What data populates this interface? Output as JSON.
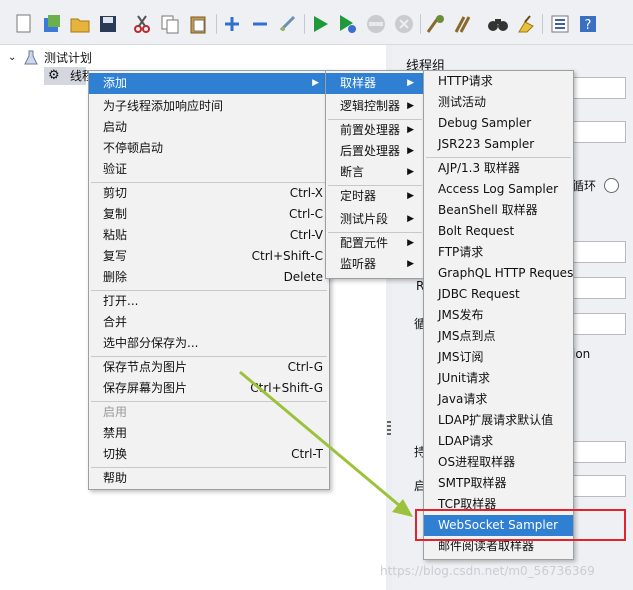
{
  "toolbar": {
    "icons": [
      "new-icon",
      "templates-icon",
      "open-icon",
      "save-icon",
      "cut-icon",
      "copy-icon",
      "paste-icon",
      "expand-icon",
      "collapse-icon",
      "toggle-icon",
      "start-icon",
      "start-no-pause-icon",
      "stop-icon",
      "shutdown-icon",
      "clear-icon",
      "clear-all-icon",
      "search-icon",
      "reset-search-icon",
      "function-helper-icon",
      "help-icon"
    ]
  },
  "tree": {
    "root_label": "测试计划",
    "child_label": "线程组"
  },
  "right_panel": {
    "title": "线程组",
    "frag_loop": "循环",
    "frag_r": "R",
    "frag_wei": "循",
    "frag_ion": "ion",
    "frag_chi": "持",
    "frag_qi": "启"
  },
  "context_menu": {
    "items": [
      {
        "label": "添加",
        "shortcut": "",
        "submenu": true,
        "highlighted": true
      },
      {
        "label": "为子线程添加响应时间",
        "shortcut": ""
      },
      {
        "label": "启动",
        "shortcut": ""
      },
      {
        "label": "不停顿启动",
        "shortcut": ""
      },
      {
        "label": "验证",
        "shortcut": ""
      },
      {
        "label": "剪切",
        "shortcut": "Ctrl-X"
      },
      {
        "label": "复制",
        "shortcut": "Ctrl-C"
      },
      {
        "label": "粘贴",
        "shortcut": "Ctrl-V"
      },
      {
        "label": "复写",
        "shortcut": "Ctrl+Shift-C"
      },
      {
        "label": "删除",
        "shortcut": "Delete"
      },
      {
        "label": "打开...",
        "shortcut": ""
      },
      {
        "label": "合并",
        "shortcut": ""
      },
      {
        "label": "选中部分保存为...",
        "shortcut": ""
      },
      {
        "label": "保存节点为图片",
        "shortcut": "Ctrl-G"
      },
      {
        "label": "保存屏幕为图片",
        "shortcut": "Ctrl+Shift-G"
      },
      {
        "label": "启用",
        "shortcut": "",
        "disabled": true
      },
      {
        "label": "禁用",
        "shortcut": ""
      },
      {
        "label": "切换",
        "shortcut": "Ctrl-T"
      },
      {
        "label": "帮助",
        "shortcut": ""
      }
    ]
  },
  "add_submenu": {
    "items": [
      {
        "label": "取样器",
        "highlighted": true
      },
      {
        "label": "逻辑控制器"
      },
      {
        "label": "前置处理器"
      },
      {
        "label": "后置处理器"
      },
      {
        "label": "断言"
      },
      {
        "label": "定时器"
      },
      {
        "label": "测试片段"
      },
      {
        "label": "配置元件"
      },
      {
        "label": "监听器"
      }
    ]
  },
  "sampler_submenu": {
    "items": [
      "HTTP请求",
      "测试活动",
      "Debug Sampler",
      "JSR223 Sampler",
      "AJP/1.3 取样器",
      "Access Log Sampler",
      "BeanShell 取样器",
      "Bolt Request",
      "FTP请求",
      "GraphQL HTTP Request",
      "JDBC Request",
      "JMS发布",
      "JMS点到点",
      "JMS订阅",
      "JUnit请求",
      "Java请求",
      "LDAP扩展请求默认值",
      "LDAP请求",
      "OS进程取样器",
      "SMTP取样器",
      "TCP取样器",
      "WebSocket Sampler",
      "邮件阅读者取样器"
    ],
    "highlighted": "WebSocket Sampler"
  },
  "watermark": "https://blog.csdn.net/m0_56736369",
  "colors": {
    "highlight": "#2f7fd3",
    "annotation_box": "#e0242c",
    "arrow": "#9bc23a"
  }
}
